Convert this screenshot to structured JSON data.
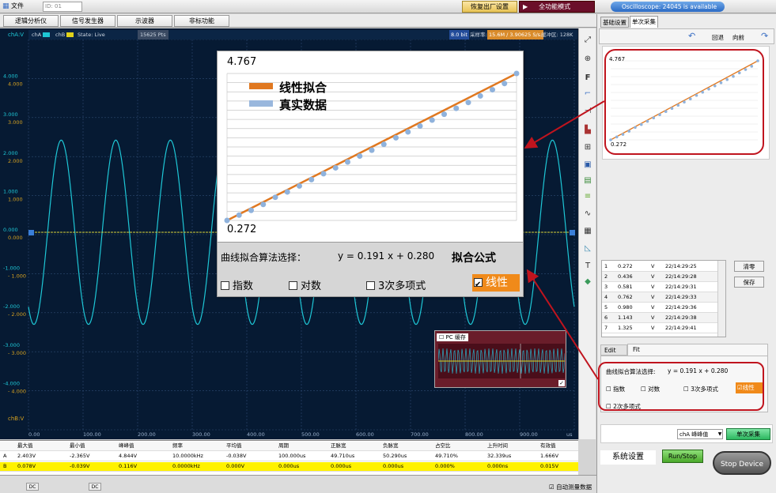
{
  "menu": {
    "file_label": "文件",
    "id_value": "ID: 01",
    "restore_label": "恢复出厂设置",
    "fullmode_label": "全功能模式",
    "update_text": "Oscilloscope: 24045 is available"
  },
  "tabs": [
    "逻辑分析仪",
    "信号发生器",
    "示波器",
    "非标功能"
  ],
  "scope": {
    "cha_axis": "chA:V",
    "chb_axis": "chB:V",
    "cha_tag": "chA",
    "chb_tag": "chB",
    "state": "State: Live",
    "points": "15625 Pts",
    "bit": "8.0 bit",
    "rate_label": "采样率:",
    "rate_value": "15.6M / 3.90625 S/s.",
    "buffer": "缓冲区: 128K",
    "y_left_a": [
      "4.000",
      "3.000",
      "2.000",
      "1.000",
      "0.000",
      "-1.000",
      "-2.000",
      "-3.000",
      "-4.000"
    ],
    "y_left_b": [
      "4.000",
      "3.000",
      "2.000",
      "1.000",
      "0.000",
      "- 1.000",
      "- 2.000",
      "- 3.000",
      "- 4.000"
    ],
    "x_ticks": [
      "0.00",
      "100.00",
      "200.00",
      "300.00",
      "400.00",
      "500.00",
      "600.00",
      "700.00",
      "800.00",
      "900.00"
    ],
    "x_unit": "us"
  },
  "callout": {
    "y_max": "4.767",
    "y_min": "0.272",
    "legend_fit": "线性拟合",
    "legend_real": "真实数据",
    "algo_label": "曲线拟合算法选择：",
    "formula": "y =  0.191 x + 0.280",
    "formula_title": "拟合公式",
    "opt_exp": "指数",
    "opt_log": "对数",
    "opt_poly3": "3次多项式",
    "opt_linear": "线性"
  },
  "chart_data": {
    "type": "scatter",
    "ylim": [
      0.272,
      4.767
    ],
    "fit": {
      "slope": 0.191,
      "intercept": 0.28
    },
    "values": [
      0.272,
      0.436,
      0.581,
      0.762,
      0.98,
      1.143,
      1.325,
      1.52,
      1.7,
      1.88,
      2.06,
      2.24,
      2.42,
      2.6,
      2.8,
      2.98,
      3.16,
      3.34,
      3.52,
      3.7,
      3.88,
      4.08,
      4.27,
      4.46,
      4.767
    ],
    "series": [
      {
        "name": "线性拟合"
      },
      {
        "name": "真实数据"
      }
    ]
  },
  "pccache": {
    "label": "PC 缓存"
  },
  "measure": {
    "headers": [
      "",
      "最大值",
      "最小值",
      "峰峰值",
      "频率",
      "平均值",
      "周期",
      "正脉宽",
      "负脉宽",
      "占空比",
      "上升时间",
      "有效值"
    ],
    "row_a": [
      "A",
      "2.403V",
      "-2.365V",
      "4.844V",
      "10.0000kHz",
      "-0.038V",
      "100.000us",
      "49.710us",
      "50.290us",
      "49.710%",
      "32.339us",
      "1.666V"
    ],
    "row_b": [
      "B",
      "0.078V",
      "-0.039V",
      "0.116V",
      "0.0000kHz",
      "0.000V",
      "0.000us",
      "0.000us",
      "0.000us",
      "0.000%",
      "0.000ns",
      "0.015V"
    ]
  },
  "bottom": {
    "dc_a": "DC",
    "dc_b": "DC",
    "auto_measure": "自动测量数据"
  },
  "right": {
    "tab_basic": "基础设置",
    "tab_single": "单次采集",
    "undo": "回退",
    "redo": "向前",
    "mini_max": "4.767",
    "mini_min": "0.272",
    "table": [
      [
        "1",
        "0.272",
        "V",
        "22/14:29:25"
      ],
      [
        "2",
        "0.436",
        "V",
        "22/14:29:28"
      ],
      [
        "3",
        "0.581",
        "V",
        "22/14:29:31"
      ],
      [
        "4",
        "0.762",
        "V",
        "22/14:29:33"
      ],
      [
        "5",
        "0.980",
        "V",
        "22/14:29:36"
      ],
      [
        "6",
        "1.143",
        "V",
        "22/14:29:38"
      ],
      [
        "7",
        "1.325",
        "V",
        "22/14:29:41"
      ]
    ],
    "clear": "清零",
    "save": "保存",
    "edit_tab": "Edit",
    "fit_tab": "Fit",
    "algo_label": "曲线拟合算法选择:",
    "formula": "y =  0.191 x + 0.280",
    "opt_exp": "指数",
    "opt_log": "对数",
    "opt_poly3": "3次多项式",
    "opt_linear": "线性",
    "opt_poly2": "2次多项式",
    "channel_select": "chA 峰峰值",
    "single_btn": "单次采集",
    "sys_settings": "系统设置",
    "run_stop": "Run/Stop",
    "stop_device": "Stop Device"
  }
}
